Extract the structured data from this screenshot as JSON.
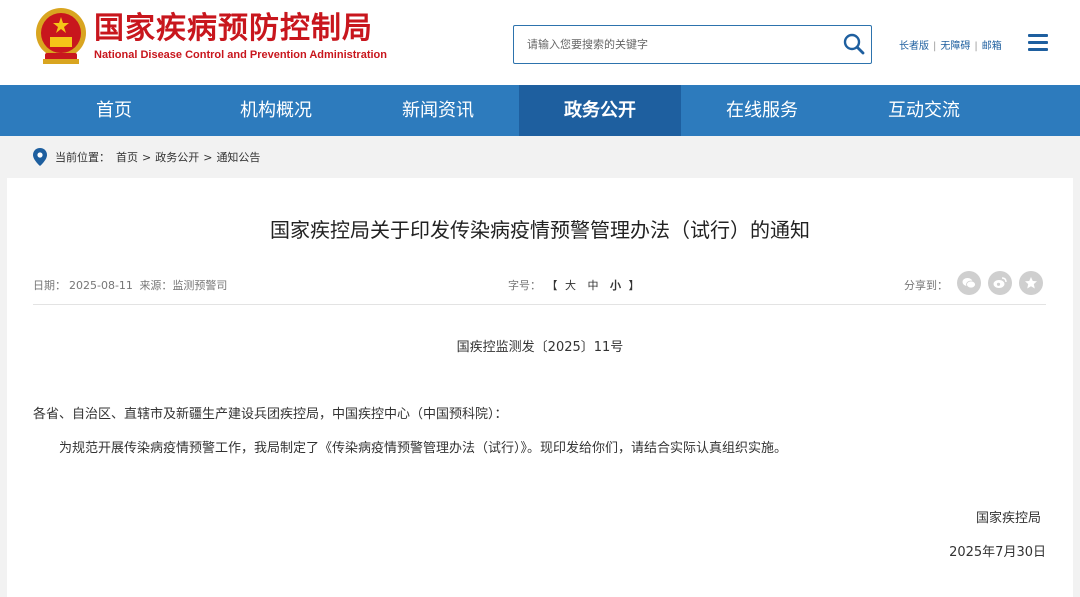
{
  "header": {
    "logo_cn": "国家疾病预防控制局",
    "logo_en": "National Disease Control and Prevention Administration",
    "search_placeholder": "请输入您要搜索的关键字",
    "links": [
      "长者版",
      "无障碍",
      "邮箱"
    ]
  },
  "nav": {
    "items": [
      "首页",
      "机构概况",
      "新闻资讯",
      "政务公开",
      "在线服务",
      "互动交流"
    ],
    "active": "政务公开"
  },
  "breadcrumb": {
    "prefix": "当前位置：",
    "items": [
      "首页",
      "政务公开",
      "通知公告"
    ],
    "separator": ">"
  },
  "article": {
    "title": "国家疾控局关于印发传染病疫情预警管理办法（试行）的通知",
    "date_label": "日期：",
    "date": "2025-08-11",
    "source_label": "来源：",
    "source": "监测预警司",
    "font_label": "字号：",
    "font_sizes": [
      "大",
      "中",
      "小"
    ],
    "selected_font_size": "小",
    "share_label": "分享到：",
    "share_icons": [
      "wechat-icon",
      "weibo-icon",
      "star-icon"
    ],
    "doc_number": "国疾控监测发〔2025〕11号",
    "salutation": "各省、自治区、直辖市及新疆生产建设兵团疾控局，中国疾控中心（中国预科院）：",
    "body": "为规范开展传染病疫情预警工作，我局制定了《传染病疫情预警管理办法（试行）》。现印发给你们，请结合实际认真组织实施。",
    "signatory": "国家疾控局",
    "sign_date": "2025年7月30日"
  },
  "colors": {
    "brand_red": "#c8161d",
    "nav_blue": "#2d7bbd",
    "nav_active": "#1e5f9f"
  }
}
